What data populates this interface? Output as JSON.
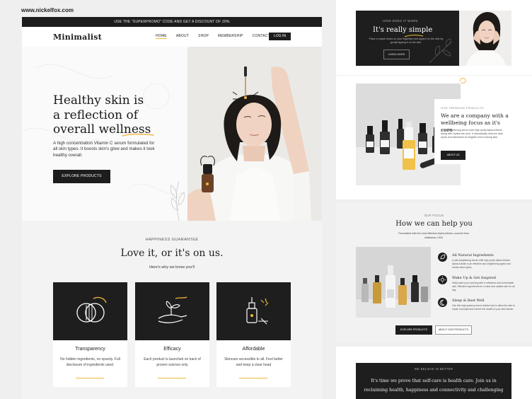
{
  "watermark": "www.nickelfox.com",
  "promo": "USE THE \"SUPERPROMO\" CODE AND GET A DISCOUNT OF 20%",
  "nav": {
    "logo": "Minimalist",
    "items": [
      "HOME",
      "ABOUT",
      "SHOP",
      "MEMBERSHIP",
      "CONTACT"
    ],
    "login": "LOG IN"
  },
  "hero": {
    "heading_lines": [
      "Healthy skin is",
      "a reflection of",
      "overall wellness"
    ],
    "body": "A high concentration Vitamin C serum formulated for all skin types. It boosts skin's glow and makes it look healthy overall.",
    "cta": "EXPLORE PRODUCTS"
  },
  "guarantee": {
    "eyebrow": "HAPPINESS GUARANTEE",
    "title": "Love it, or it's on us.",
    "subtitle": "Here's why we know you'll",
    "cards": [
      {
        "title": "Transparency",
        "body": "No hidden ingredients, no opacity. Full disclosure of ingredients used.",
        "icon": "overlapping-circles-icon"
      },
      {
        "title": "Efficacy",
        "body": "Each product is launched on back of proven science only",
        "icon": "hand-sprout-icon"
      },
      {
        "title": "Affordable",
        "body": "Skincare accessible to all. Feel better and keep a clear head",
        "icon": "serum-bottle-icon"
      }
    ]
  },
  "how_it_works": {
    "eyebrow": "HOW DOES IT WORK",
    "title": "It's really simple",
    "body": "Place a couple drops on your fingertips and apply it on the skin by gently tapping it on the skin.",
    "button": "LEARN MORE"
  },
  "trending": {
    "eyebrow": "OUR TRENDING PRODUCTS",
    "title": "We are a company with a wellbeing focus as it's core",
    "body": "A skin-brightening serum with high purity Alpha Arbutin along with Hyaluronic acid. It dramatically reduces dark spots and blemishes for brighter more looking skin.",
    "button": "ABOUT US"
  },
  "focus": {
    "eyebrow": "OUR FOCUS",
    "title": "How we can help you",
    "subtitle": "Formulated with the most effective Alpha Arbutin, sourced from Adelbaran, USA",
    "features": [
      {
        "title": "All Natural Ingredients",
        "body": "A skin-brightening serum with high purity Alpha Arbutin. Alpha Arbutin is an effective skin-brightening agent and boosts skin's glow.",
        "icon": "leaf-icon"
      },
      {
        "title": "Wake Up & Get Inspired",
        "body": "Helps start your morning with a refreshed and comfortable skin. Effective ingredients for a clear and radiant skin for all day.",
        "icon": "sun-icon"
      },
      {
        "title": "Sleep & Rest Well",
        "body": "Use this high-potency serum before bed to allow the skin to repair overnight and restore the health of your skin barrier.",
        "icon": "moon-icon"
      }
    ],
    "primary_button": "EXPLORE PRODUCTS",
    "secondary_button": "ABOUT OUR PRODUCTS"
  },
  "believe": {
    "eyebrow": "WE BELIEVE IN BETTER",
    "text": "It's time we prove that self-care is health care. Join us in reclaiming health, happiness and connectivity and challenging"
  },
  "colors": {
    "accent": "#f0b83a",
    "dark": "#1e1e1e",
    "page_bg": "#efefef"
  }
}
